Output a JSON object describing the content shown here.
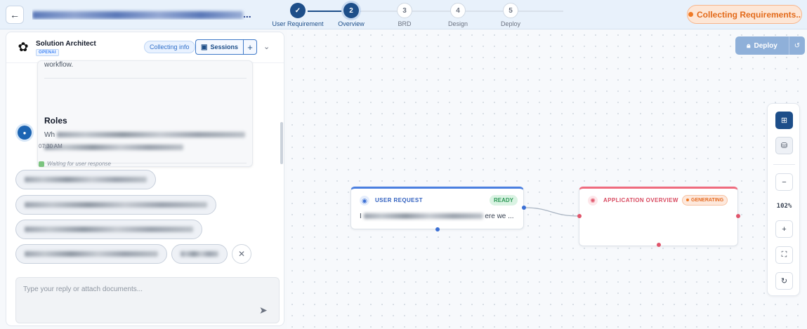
{
  "topbar": {
    "back_icon": "arrow-left-icon",
    "title_suffix": "..."
  },
  "stepper": {
    "steps": [
      {
        "number": "✓",
        "label": "User Requirement",
        "state": "done"
      },
      {
        "number": "2",
        "label": "Overview",
        "state": "active"
      },
      {
        "number": "3",
        "label": "BRD",
        "state": "todo"
      },
      {
        "number": "4",
        "label": "Design",
        "state": "todo"
      },
      {
        "number": "5",
        "label": "Deploy",
        "state": "todo"
      }
    ]
  },
  "status": {
    "label": "Collecting Requirements..",
    "color": "#e36a1a"
  },
  "chat": {
    "agent_name": "Solution Architect",
    "agent_badge": "OPENAI",
    "collecting_pill": "Collecting info",
    "sessions_label": "Sessions",
    "add_label": "+",
    "message": {
      "workflow_text": "workflow.",
      "roles_heading": "Roles",
      "question_start": "Wh",
      "question_end": ""
    },
    "timestamp": "07:30 AM",
    "waiting_text": "Waiting for user response",
    "close_label": "✕",
    "reply_placeholder": "Type your reply or attach documents..."
  },
  "canvas": {
    "deploy_label": "Deploy",
    "zoom_level": "102%",
    "zoom_out_label": "−",
    "zoom_in_label": "+",
    "nodes": {
      "user_request": {
        "title": "USER REQUEST",
        "badge": "READY",
        "body_start": "I",
        "body_end": "ere we ..."
      },
      "app_overview": {
        "title": "APPLICATION OVERVIEW",
        "badge": "GENERATING"
      }
    }
  },
  "colors": {
    "primary": "#1d4e89",
    "ready": "#2f9a58",
    "generating": "#e56b22",
    "node_request_accent": "#4a7fe0",
    "node_overview_accent": "#ef6b7e"
  }
}
